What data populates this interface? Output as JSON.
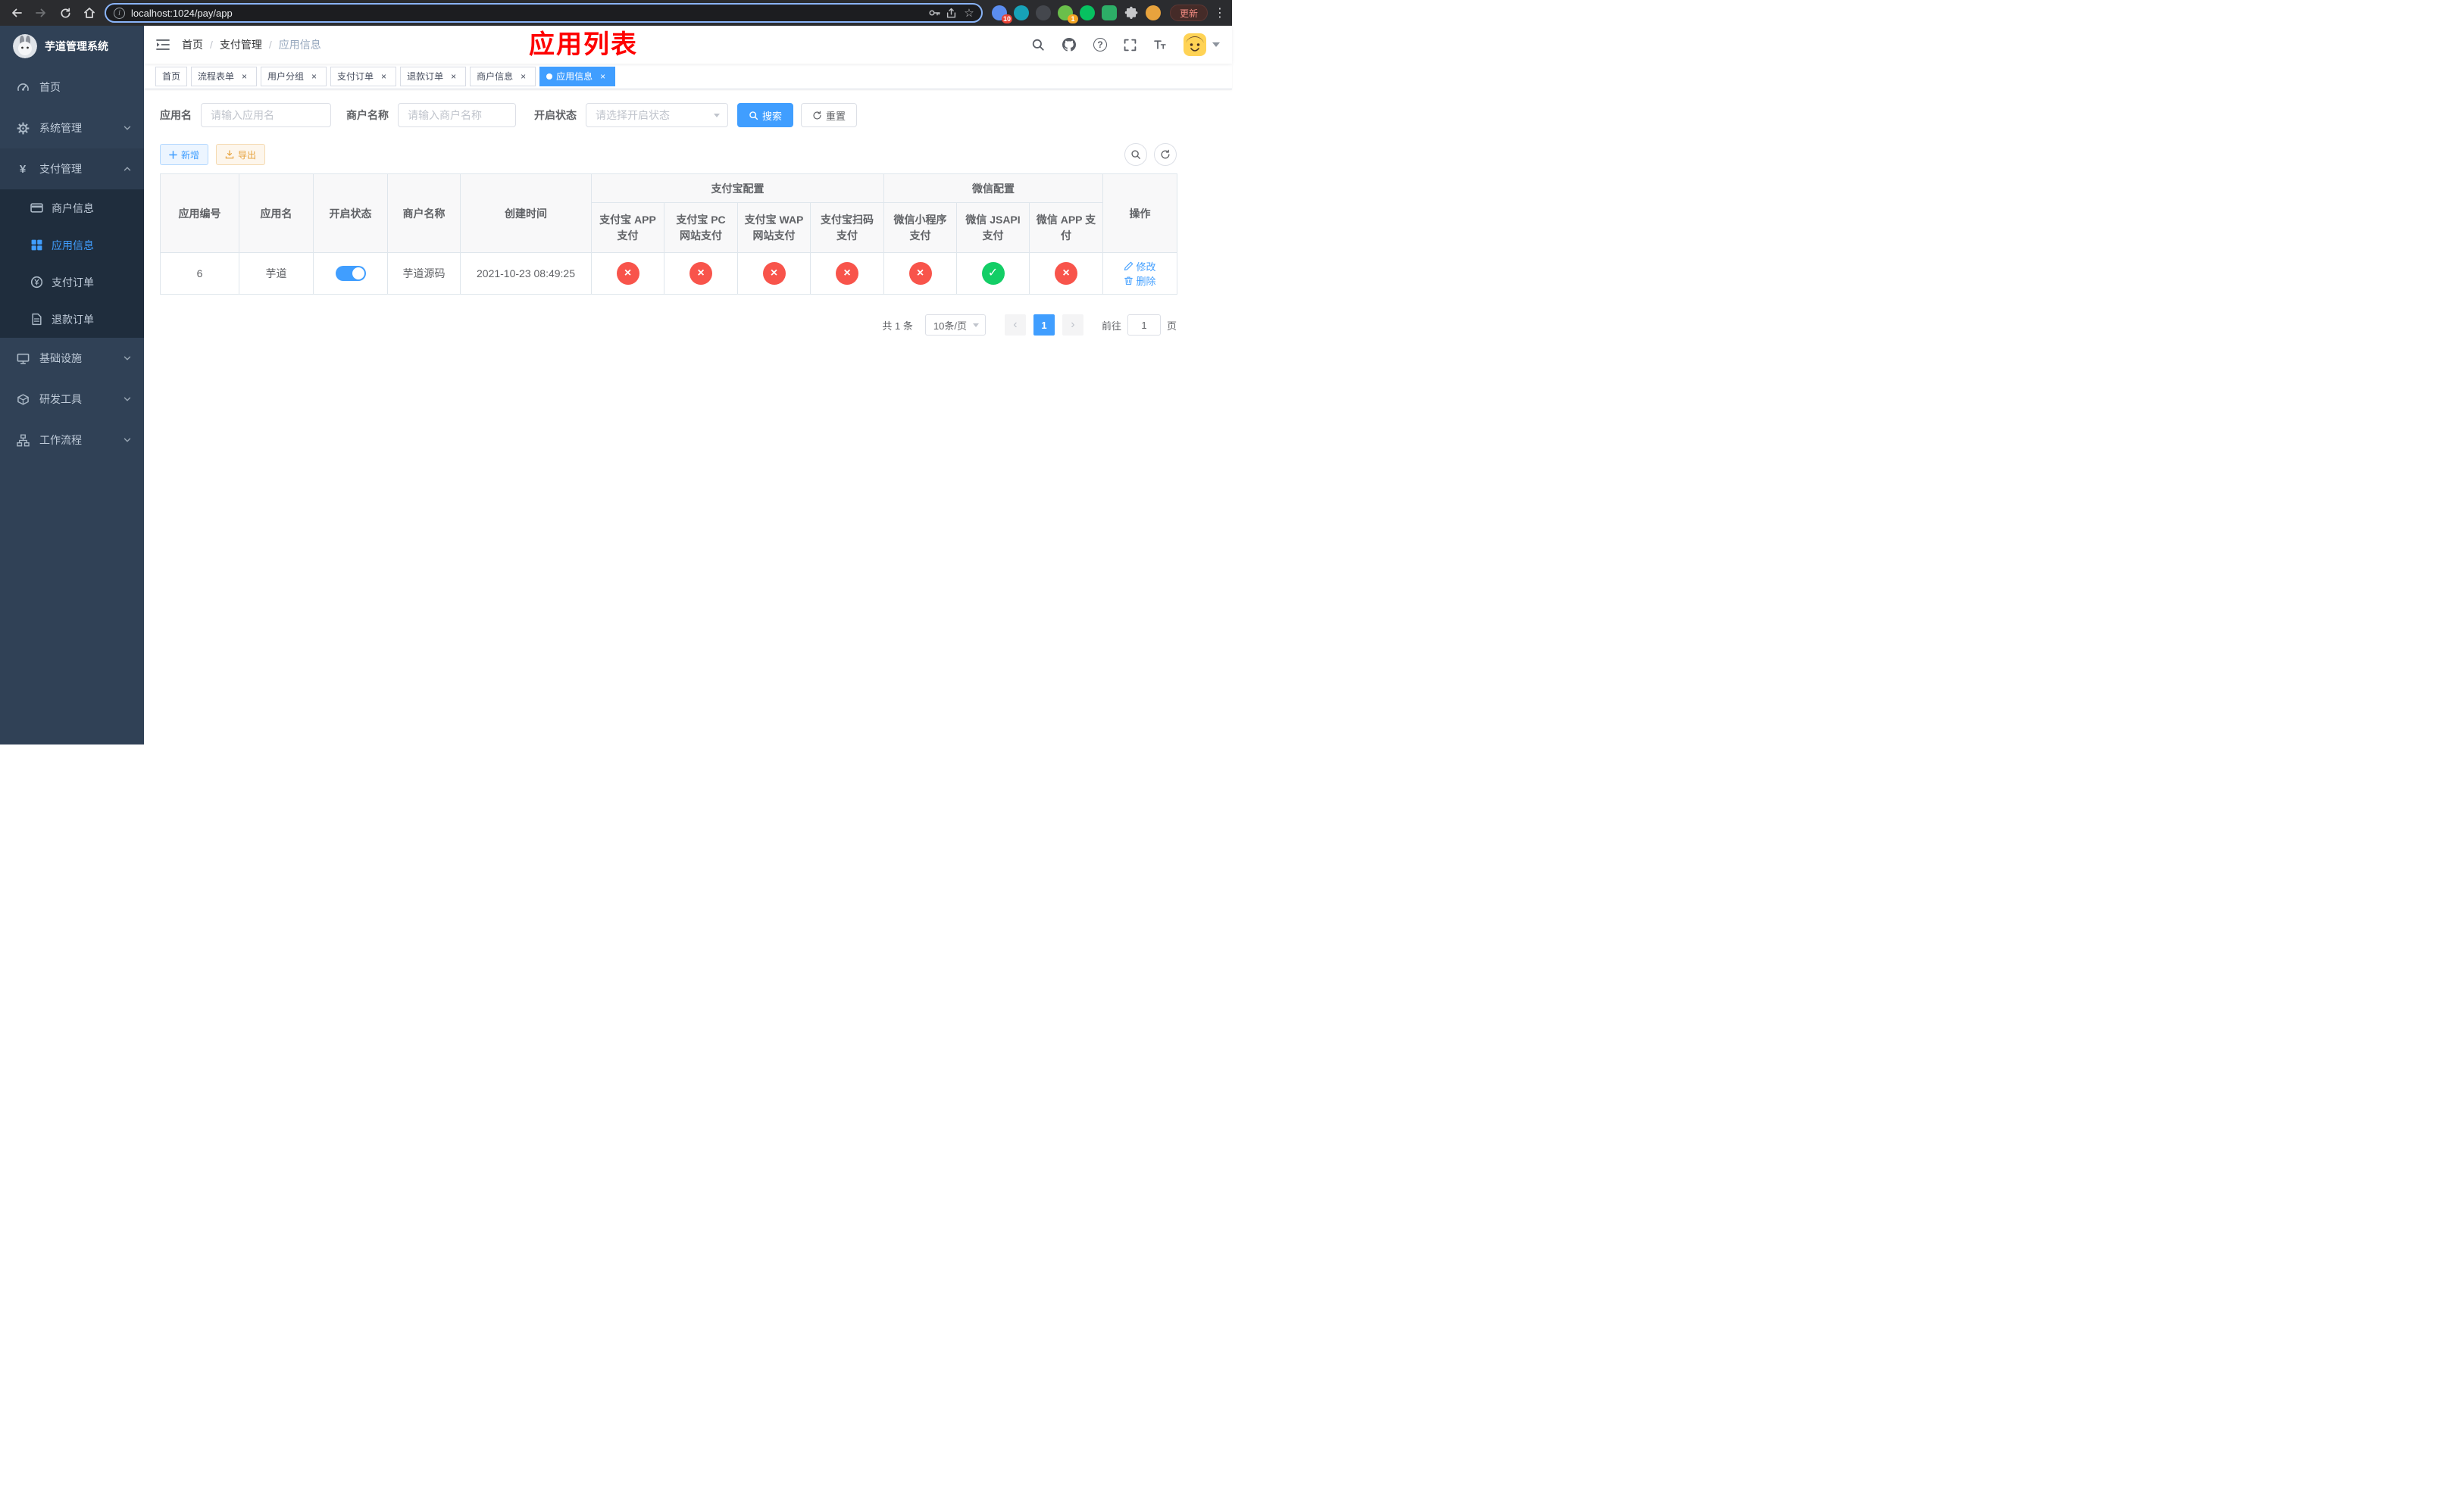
{
  "colors": {
    "accent": "#409EFF",
    "success": "#13CE66",
    "danger": "#F8544B"
  },
  "icons": {
    "check": "✓",
    "cross": "×"
  },
  "browser": {
    "url": "localhost:1024/pay/app",
    "update_button": "更新",
    "extensions": [
      {
        "name": "extension-grid-icon",
        "color": "#5b8def",
        "badge": "10",
        "badge_color": "#e94235"
      },
      {
        "name": "extension-teal-icon",
        "color": "#17a2b8",
        "badge": ""
      },
      {
        "name": "extension-dark-icon",
        "color": "#44474d",
        "badge": ""
      },
      {
        "name": "extension-avatar-green-icon",
        "color": "#6abf4b",
        "badge": "1",
        "badge_color": "#f5a623"
      },
      {
        "name": "extension-wechat-icon",
        "color": "#07c160",
        "badge": ""
      },
      {
        "name": "extension-chat-square-icon",
        "color": "#2dae67",
        "badge": ""
      },
      {
        "name": "extensions-puzzle-icon",
        "color": "",
        "badge": ""
      },
      {
        "name": "profile-avatar-icon",
        "color": "#e8a33d",
        "badge": ""
      }
    ]
  },
  "sidebar": {
    "logo_title": "芋道管理系统",
    "items": [
      {
        "key": "home",
        "label": "首页",
        "icon": "dashboard-icon",
        "expandable": false,
        "expanded": false
      },
      {
        "key": "system",
        "label": "系统管理",
        "icon": "gear-icon",
        "expandable": true,
        "expanded": false
      },
      {
        "key": "payment",
        "label": "支付管理",
        "icon": "yen-icon",
        "expandable": true,
        "expanded": true,
        "children": [
          {
            "key": "merchant-info",
            "label": "商户信息",
            "icon": "card-icon",
            "active": false
          },
          {
            "key": "app-info",
            "label": "应用信息",
            "icon": "grid-icon",
            "active": true
          },
          {
            "key": "pay-order",
            "label": "支付订单",
            "icon": "order-icon",
            "active": false
          },
          {
            "key": "refund-order",
            "label": "退款订单",
            "icon": "document-icon",
            "active": false
          }
        ]
      },
      {
        "key": "infra",
        "label": "基础设施",
        "icon": "monitor-icon",
        "expandable": true,
        "expanded": false
      },
      {
        "key": "devtools",
        "label": "研发工具",
        "icon": "toolbox-icon",
        "expandable": true,
        "expanded": false
      },
      {
        "key": "workflow",
        "label": "工作流程",
        "icon": "workflow-icon",
        "expandable": true,
        "expanded": false
      }
    ]
  },
  "navbar": {
    "breadcrumb": [
      "首页",
      "支付管理",
      "应用信息"
    ],
    "annotation": "应用列表"
  },
  "tabs": [
    {
      "key": "home",
      "label": "首页",
      "closable": false,
      "active": false
    },
    {
      "key": "flow-form",
      "label": "流程表单",
      "closable": true,
      "active": false
    },
    {
      "key": "user-group",
      "label": "用户分组",
      "closable": true,
      "active": false
    },
    {
      "key": "pay-order",
      "label": "支付订单",
      "closable": true,
      "active": false
    },
    {
      "key": "refund-order",
      "label": "退款订单",
      "closable": true,
      "active": false
    },
    {
      "key": "merchant-info",
      "label": "商户信息",
      "closable": true,
      "active": false
    },
    {
      "key": "app-info",
      "label": "应用信息",
      "closable": true,
      "active": true
    }
  ],
  "filters": {
    "app_name_label": "应用名",
    "app_name_placeholder": "请输入应用名",
    "merchant_label": "商户名称",
    "merchant_placeholder": "请输入商户名称",
    "status_label": "开启状态",
    "status_placeholder": "请选择开启状态",
    "search_button": "搜索",
    "reset_button": "重置"
  },
  "toolbar": {
    "add_button": "新增",
    "export_button": "导出"
  },
  "table": {
    "main_columns": [
      "应用编号",
      "应用名",
      "开启状态",
      "商户名称",
      "创建时间"
    ],
    "alipay_group": "支付宝配置",
    "wechat_group": "微信配置",
    "alipay_columns": [
      "支付宝 APP 支付",
      "支付宝 PC 网站支付",
      "支付宝 WAP 网站支付",
      "支付宝扫码支付"
    ],
    "wechat_columns": [
      "微信小程序支付",
      "微信 JSAPI 支付",
      "微信 APP 支付"
    ],
    "ops_column": "操作",
    "rows": [
      {
        "id": "6",
        "name": "芋道",
        "enabled": true,
        "merchant": "芋道源码",
        "created": "2021-10-23 08:49:25",
        "alipay": [
          false,
          false,
          false,
          false
        ],
        "wechat": [
          false,
          true,
          false
        ],
        "edit_label": "修改",
        "delete_label": "删除"
      }
    ]
  },
  "pagination": {
    "total": "共 1 条",
    "page_size": "10条/页",
    "current_page": "1",
    "goto_label": "前往",
    "goto_value": "1",
    "goto_suffix": "页"
  }
}
